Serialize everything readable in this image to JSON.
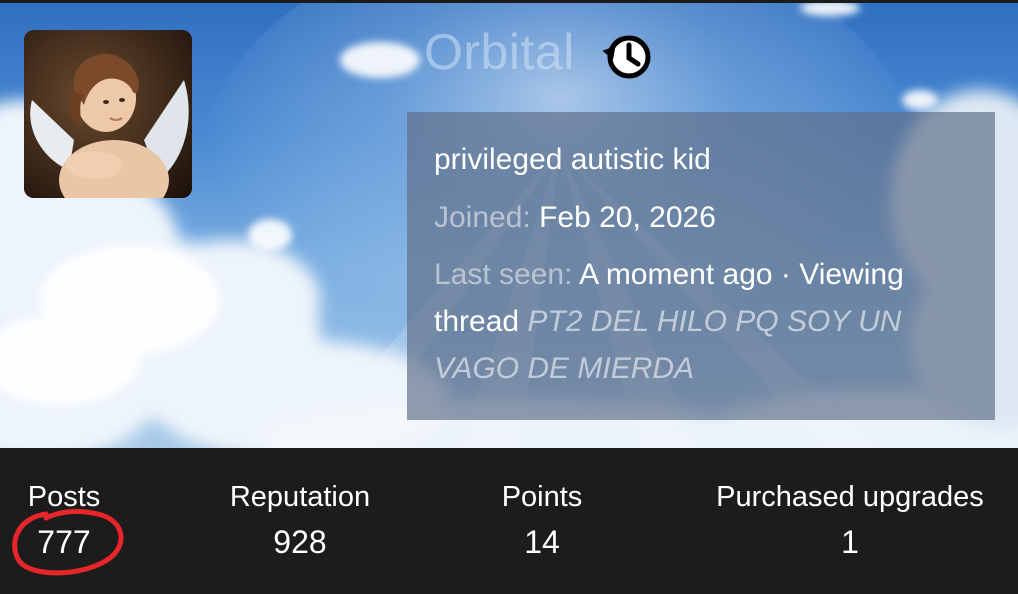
{
  "profile": {
    "username": "Orbital",
    "custom_title": "privileged autistic kid",
    "joined_label": "Joined:",
    "joined_value": "Feb 20, 2026",
    "last_seen_label": "Last seen:",
    "last_seen_value": "A moment ago · Viewing",
    "activity_prefix": "thread",
    "thread_title_line1": "PT2 DEL HILO PQ SOY UN",
    "thread_title_line2": "VAGO DE MIERDA"
  },
  "stats": [
    {
      "label": "Posts",
      "value": "777"
    },
    {
      "label": "Reputation",
      "value": "928"
    },
    {
      "label": "Points",
      "value": "14"
    },
    {
      "label": "Purchased upgrades",
      "value": "1"
    }
  ],
  "icons": {
    "history": "username-history-icon",
    "avatar": "cherub-avatar"
  },
  "colors": {
    "stats_background": "#1c1c1c",
    "annotation": "#e8262a"
  }
}
